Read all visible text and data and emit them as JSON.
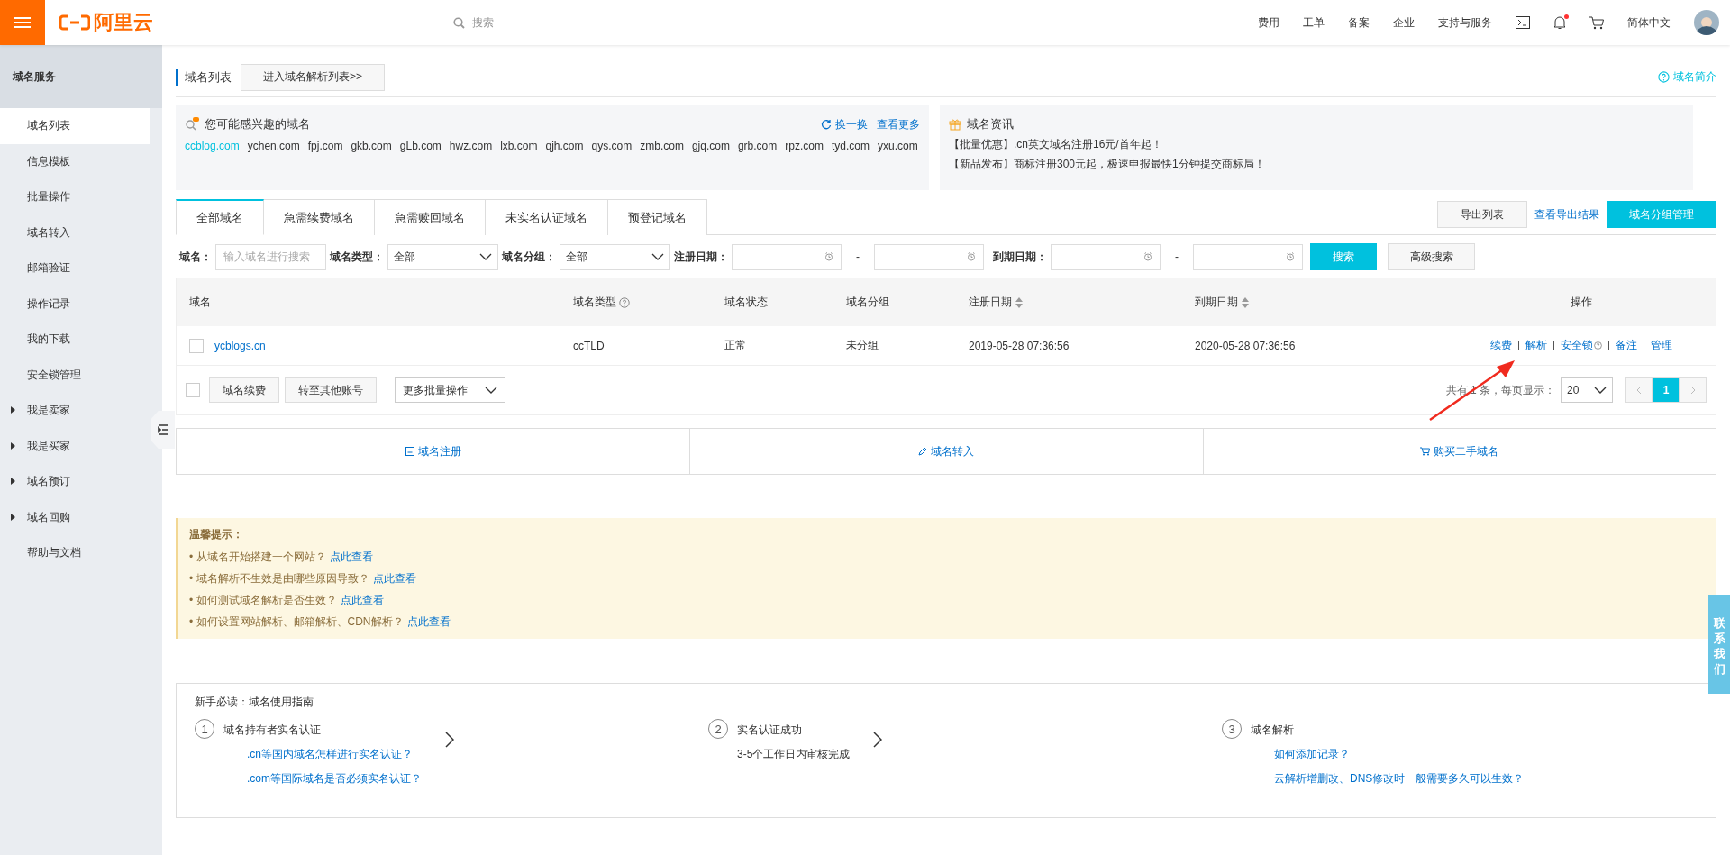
{
  "topbar": {
    "logo": "阿里云",
    "search_placeholder": "搜索",
    "nav": [
      "费用",
      "工单",
      "备案",
      "企业",
      "支持与服务"
    ],
    "notification": true,
    "language": "简体中文"
  },
  "sidebar": {
    "title": "域名服务",
    "items": [
      {
        "label": "域名列表",
        "kind": "link",
        "selected": true
      },
      {
        "label": "信息模板",
        "kind": "link",
        "selected": false
      },
      {
        "label": "批量操作",
        "kind": "link",
        "selected": false
      },
      {
        "label": "域名转入",
        "kind": "link",
        "selected": false
      },
      {
        "label": "邮箱验证",
        "kind": "link",
        "selected": false
      },
      {
        "label": "操作记录",
        "kind": "link",
        "selected": false
      },
      {
        "label": "我的下载",
        "kind": "link",
        "selected": false
      },
      {
        "label": "安全锁管理",
        "kind": "link",
        "selected": false
      },
      {
        "label": "我是卖家",
        "kind": "group",
        "selected": false
      },
      {
        "label": "我是买家",
        "kind": "group",
        "selected": false
      },
      {
        "label": "域名预订",
        "kind": "group",
        "selected": false
      },
      {
        "label": "域名回购",
        "kind": "group",
        "selected": false
      },
      {
        "label": "帮助与文档",
        "kind": "link",
        "selected": false
      }
    ]
  },
  "header": {
    "title": "域名列表",
    "button": "进入域名解析列表>>",
    "help": "域名简介"
  },
  "interest": {
    "title": "您可能感兴趣的域名",
    "refresh": "换一换",
    "more": "查看更多",
    "domains": [
      {
        "text": "ccblog.com",
        "highlight": true
      },
      {
        "text": "ychen.com",
        "highlight": false
      },
      {
        "text": "fpj.com",
        "highlight": false
      },
      {
        "text": "gkb.com",
        "highlight": false
      },
      {
        "text": "gLb.com",
        "highlight": false
      },
      {
        "text": "hwz.com",
        "highlight": false
      },
      {
        "text": "lxb.com",
        "highlight": false
      },
      {
        "text": "qjh.com",
        "highlight": false
      },
      {
        "text": "qys.com",
        "highlight": false
      },
      {
        "text": "zmb.com",
        "highlight": false
      },
      {
        "text": "gjq.com",
        "highlight": false
      },
      {
        "text": "grb.com",
        "highlight": false
      },
      {
        "text": "rpz.com",
        "highlight": false
      },
      {
        "text": "tyd.com",
        "highlight": false
      },
      {
        "text": "yxu.com",
        "highlight": false
      }
    ]
  },
  "news": {
    "title": "域名资讯",
    "lines": [
      "【批量优惠】.cn英文域名注册16元/首年起！",
      "【新品发布】商标注册300元起，极速申报最快1分钟提交商标局！"
    ]
  },
  "tabs": [
    {
      "label": "全部域名",
      "selected": true
    },
    {
      "label": "急需续费域名",
      "selected": false
    },
    {
      "label": "急需赎回域名",
      "selected": false
    },
    {
      "label": "未实名认证域名",
      "selected": false
    },
    {
      "label": "预登记域名",
      "selected": false
    }
  ],
  "tab_actions": {
    "export": "导出列表",
    "view_export": "查看导出结果",
    "group_manage": "域名分组管理"
  },
  "filters": {
    "domain_label": "域名：",
    "domain_placeholder": "输入域名进行搜索",
    "type_label": "域名类型：",
    "type_value": "全部",
    "group_label": "域名分组：",
    "group_value": "全部",
    "reg_label": "注册日期：",
    "exp_label": "到期日期：",
    "dash": "-",
    "search": "搜索",
    "advanced": "高级搜索"
  },
  "table": {
    "columns": [
      {
        "label": "域名",
        "kind": "plain"
      },
      {
        "label": "域名类型",
        "kind": "help"
      },
      {
        "label": "域名状态",
        "kind": "plain"
      },
      {
        "label": "域名分组",
        "kind": "plain"
      },
      {
        "label": "注册日期",
        "kind": "sort"
      },
      {
        "label": "到期日期",
        "kind": "sort"
      },
      {
        "label": "操作",
        "kind": "plain"
      }
    ],
    "rows": [
      {
        "checked": false,
        "domain": "ycblogs.cn",
        "type": "ccTLD",
        "status": "正常",
        "group": "未分组",
        "registered": "2019-05-28 07:36:56",
        "expires": "2020-05-28 07:36:56",
        "actions": [
          {
            "label": "续费",
            "help": false,
            "underlined": false
          },
          {
            "label": "解析",
            "help": false,
            "underlined": true
          },
          {
            "label": "安全锁",
            "help": true,
            "underlined": false
          },
          {
            "label": "备注",
            "help": false,
            "underlined": false
          },
          {
            "label": "管理",
            "help": false,
            "underlined": false
          }
        ]
      }
    ],
    "footer": {
      "checked": false,
      "buttons": [
        "域名续费",
        "转至其他账号"
      ],
      "batch": "更多批量操作",
      "total": "共有 1 条，每页显示：",
      "page_size": "20",
      "pages": [
        {
          "label": "1",
          "selected": true
        }
      ]
    }
  },
  "quick_links": [
    "域名注册",
    "域名转入",
    "购买二手域名"
  ],
  "tips": {
    "title": "温馨提示：",
    "items": [
      {
        "text": "• 从域名开始搭建一个网站？",
        "link": "点此查看"
      },
      {
        "text": "• 域名解析不生效是由哪些原因导致？",
        "link": "点此查看"
      },
      {
        "text": "• 如何测试域名解析是否生效？",
        "link": "点此查看"
      },
      {
        "text": "• 如何设置网站解析、邮箱解析、CDN解析？",
        "link": "点此查看"
      }
    ]
  },
  "guide": {
    "title": "新手必读：域名使用指南",
    "steps": [
      {
        "number": "1",
        "title": "域名持有者实名认证",
        "lines": [
          {
            "text": ".cn等国内域名怎样进行实名认证？",
            "kind": "link"
          },
          {
            "text": ".com等国际域名是否必须实名认证？",
            "kind": "link"
          }
        ]
      },
      {
        "number": "2",
        "title": "实名认证成功",
        "lines": [
          {
            "text": "3-5个工作日内审核完成",
            "kind": "text"
          }
        ]
      },
      {
        "number": "3",
        "title": "域名解析",
        "lines": [
          {
            "text": "如何添加记录？",
            "kind": "link"
          },
          {
            "text": "云解析增删改、DNS修改时一般需要多久可以生效？",
            "kind": "link"
          }
        ]
      }
    ]
  },
  "contact": "联系我们"
}
